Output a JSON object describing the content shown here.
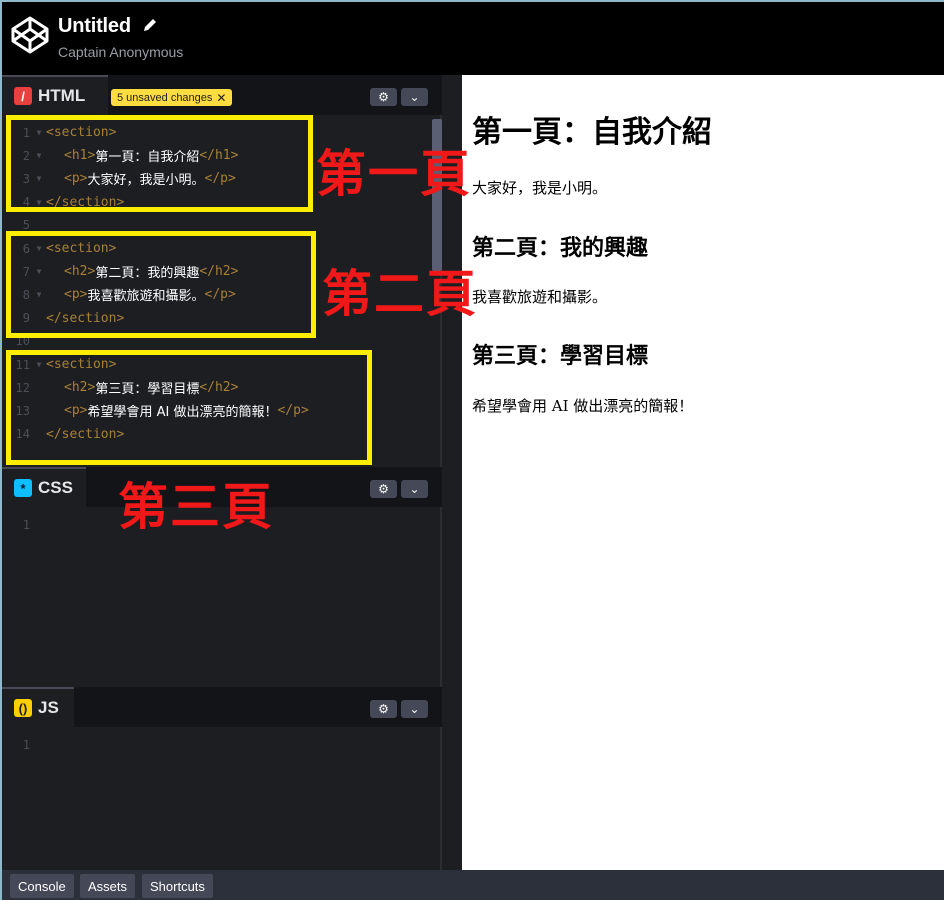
{
  "header": {
    "title": "Untitled",
    "author": "Captain Anonymous"
  },
  "html_pane": {
    "label": "HTML",
    "icon": "html-icon",
    "unsaved_badge": "5 unsaved changes",
    "unsaved_close": "✕",
    "lines": [
      {
        "n": "1",
        "indent": 0,
        "open": "<section>",
        "text": "",
        "close": ""
      },
      {
        "n": "2",
        "indent": 1,
        "open": "<h1>",
        "text": "第一頁：自我介紹",
        "close": "</h1>"
      },
      {
        "n": "3",
        "indent": 1,
        "open": "<p>",
        "text": "大家好，我是小明。",
        "close": "</p>"
      },
      {
        "n": "4",
        "indent": 0,
        "open": "</section>",
        "text": "",
        "close": ""
      },
      {
        "n": "5",
        "indent": 0,
        "open": "",
        "text": "",
        "close": ""
      },
      {
        "n": "6",
        "indent": 0,
        "open": "<section>",
        "text": "",
        "close": ""
      },
      {
        "n": "7",
        "indent": 1,
        "open": "<h2>",
        "text": "第二頁：我的興趣",
        "close": "</h2>"
      },
      {
        "n": "8",
        "indent": 1,
        "open": "<p>",
        "text": "我喜歡旅遊和攝影。",
        "close": "</p>"
      },
      {
        "n": "9",
        "indent": 0,
        "open": "</section>",
        "text": "",
        "close": ""
      },
      {
        "n": "10",
        "indent": 0,
        "open": "",
        "text": "",
        "close": ""
      },
      {
        "n": "11",
        "indent": 0,
        "open": "<section>",
        "text": "",
        "close": ""
      },
      {
        "n": "12",
        "indent": 1,
        "open": "<h2>",
        "text": "第三頁：學習目標",
        "close": "</h2>"
      },
      {
        "n": "13",
        "indent": 1,
        "open": "<p>",
        "text": "希望學會用 AI 做出漂亮的簡報！",
        "close": "</p>"
      },
      {
        "n": "14",
        "indent": 0,
        "open": "</section>",
        "text": "",
        "close": ""
      }
    ]
  },
  "css_pane": {
    "label": "CSS",
    "icon": "css-icon",
    "line1": "1"
  },
  "js_pane": {
    "label": "JS",
    "icon": "js-icon",
    "line1": "1"
  },
  "annotations": {
    "page1": "第一頁",
    "page2": "第二頁",
    "page3": "第三頁",
    "highlight_color": "#ffee00",
    "label_color": "#f01818"
  },
  "preview": {
    "h1": "第一頁：自我介紹",
    "p1": "大家好，我是小明。",
    "h2a": "第二頁：我的興趣",
    "p2": "我喜歡旅遊和攝影。",
    "h2b": "第三頁：學習目標",
    "p3": "希望學會用 AI 做出漂亮的簡報！"
  },
  "footer": {
    "console": "Console",
    "assets": "Assets",
    "shortcuts": "Shortcuts"
  }
}
